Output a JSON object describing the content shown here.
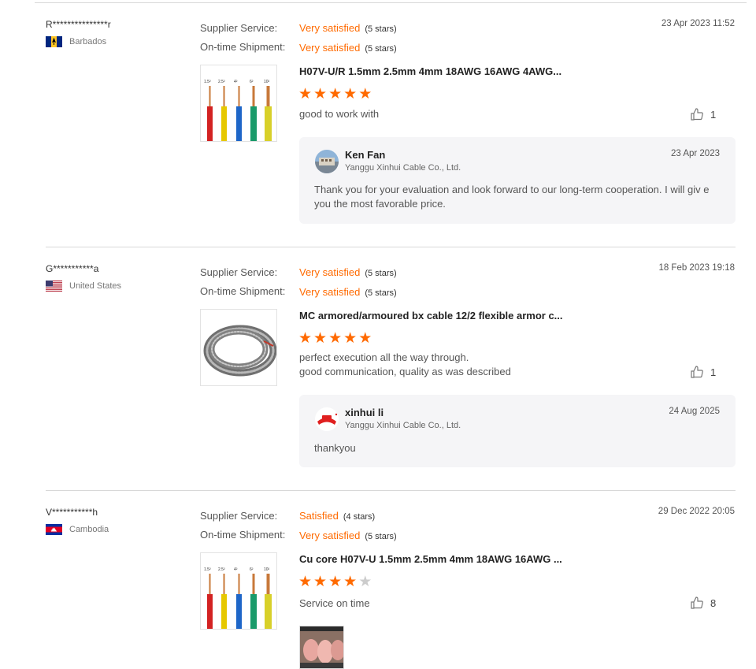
{
  "reviews": [
    {
      "buyer": "R***************r",
      "country": "Barbados",
      "supplier_service_label": "Supplier Service:",
      "shipment_label": "On-time Shipment:",
      "supplier_service_value": "Very satisfied",
      "supplier_service_stars": "(5 stars)",
      "shipment_value": "Very satisfied",
      "shipment_stars": "(5 stars)",
      "date": "23 Apr 2023 11:52",
      "product_title": "H07V-U/R 1.5mm 2.5mm 4mm 18AWG 16AWG 4AWG...",
      "rating": 5,
      "comment": "good to work with",
      "likes": "1",
      "reply": {
        "name": "Ken Fan",
        "company": "Yanggu Xinhui Cable Co., Ltd.",
        "date": "23 Apr 2023",
        "text": "Thank you for your evaluation and look forward to our long-term cooperation. I will giv e you the most favorable price."
      }
    },
    {
      "buyer": "G***********a",
      "country": "United States",
      "supplier_service_label": "Supplier Service:",
      "shipment_label": "On-time Shipment:",
      "supplier_service_value": "Very satisfied",
      "supplier_service_stars": "(5 stars)",
      "shipment_value": "Very satisfied",
      "shipment_stars": "(5 stars)",
      "date": "18 Feb 2023 19:18",
      "product_title": "MC armored/armoured bx cable 12/2 flexible armor c...",
      "rating": 5,
      "comment_line1": "perfect execution all the way through.",
      "comment_line2": "good communication, quality as was described",
      "likes": "1",
      "reply": {
        "name": "xinhui li",
        "company": "Yanggu Xinhui Cable Co., Ltd.",
        "date": "24 Aug 2025",
        "text": "thankyou"
      }
    },
    {
      "buyer": "V***********h",
      "country": "Cambodia",
      "supplier_service_label": "Supplier Service:",
      "shipment_label": "On-time Shipment:",
      "supplier_service_value": "Satisfied",
      "supplier_service_stars": "(4 stars)",
      "shipment_value": "Very satisfied",
      "shipment_stars": "(5 stars)",
      "date": "29 Dec 2022 20:05",
      "product_title": "Cu core H07V-U 1.5mm 2.5mm 4mm 18AWG 16AWG ...",
      "rating": 4,
      "comment": "Service on time",
      "likes": "8"
    }
  ],
  "wire_labels": [
    "1.5²",
    "2.5²",
    "4²",
    "6²",
    "10²"
  ],
  "colors": {
    "accent": "#ff6a00",
    "star_off": "#cccccc",
    "reply_bg": "#f5f5f7"
  },
  "icons": [
    "thumbs-up-icon",
    "flag-barbados-icon",
    "flag-us-icon",
    "flag-cambodia-icon",
    "star-icon"
  ]
}
